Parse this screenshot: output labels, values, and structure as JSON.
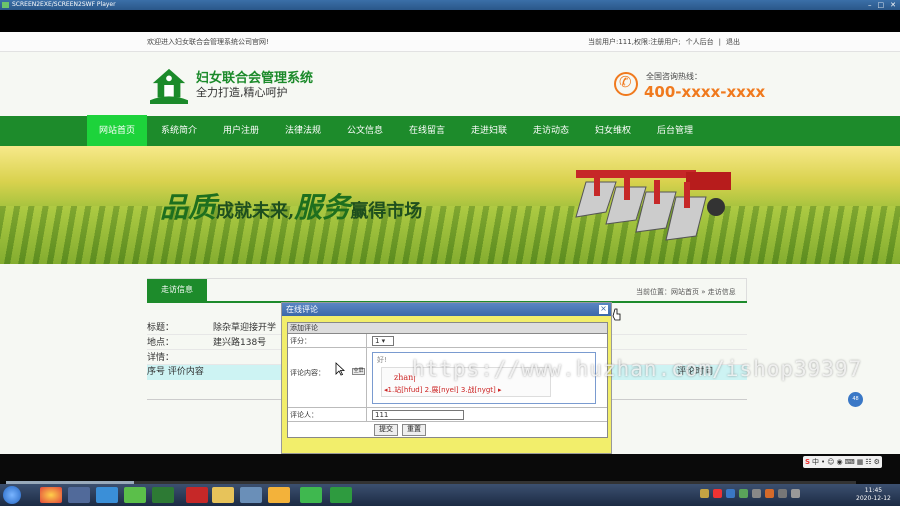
{
  "player": {
    "title": "SCREEN2EXE/SCREEN2SWF Player"
  },
  "topbar": {
    "welcome": "欢迎进入妇女联合会管理系统公司官网!",
    "current_user": "当前用户:111,权限:注册用户;",
    "personal": "个人后台",
    "separator": "|",
    "logout": "退出"
  },
  "header": {
    "site_title": "妇女联合会管理系统",
    "slogan": "全力打造,精心呵护",
    "hotline_label": "全国咨询热线：",
    "hotline": "400-xxxx-xxxx"
  },
  "nav": [
    {
      "label": "网站首页",
      "active": true
    },
    {
      "label": "系统简介"
    },
    {
      "label": "用户注册"
    },
    {
      "label": "法律法规"
    },
    {
      "label": "公文信息"
    },
    {
      "label": "在线留言"
    },
    {
      "label": "走进妇联"
    },
    {
      "label": "走访动态"
    },
    {
      "label": "妇女维权"
    },
    {
      "label": "后台管理"
    }
  ],
  "banner": {
    "big": "品质",
    "mid1": "成就未来,",
    "big2": "服务",
    "mid2": "赢得市场"
  },
  "section": {
    "tab": "走访信息",
    "breadcrumb": "当前位置：网站首页 » 走访信息"
  },
  "detail": {
    "title_label": "标题：",
    "title_value": "除杂草迎接开学",
    "address_label": "地点：",
    "address_value": "建兴路138号",
    "detail_label": "详情：",
    "col_no": "序号 评价内容",
    "col_time": "评论时间"
  },
  "dialog": {
    "title": "在线评论",
    "close": "×",
    "section": "添加评论",
    "score_label": "评分：",
    "score_value": "1 ▾",
    "content_label": "评论内容：",
    "mini_icon": "全屏",
    "editor_hint": "好!",
    "ime_word": "zhan|",
    "ime_candidates": "◂1.站[hfud] 2.展[nyel] 3.战[nygt] ▸",
    "commenter_label": "评论人：",
    "commenter_value": "111",
    "submit": "提交",
    "reset": "重置"
  },
  "watermark": {
    "text": "https://www.huzhan.com/ishop39397",
    "badge": "48"
  },
  "ime_bar": {
    "items": [
      "S",
      "中",
      "•",
      "☺",
      "◉",
      "⌨",
      "▦",
      "☷",
      "⚙"
    ]
  },
  "clock": {
    "time": "11:45",
    "date": "2020-12-12"
  }
}
